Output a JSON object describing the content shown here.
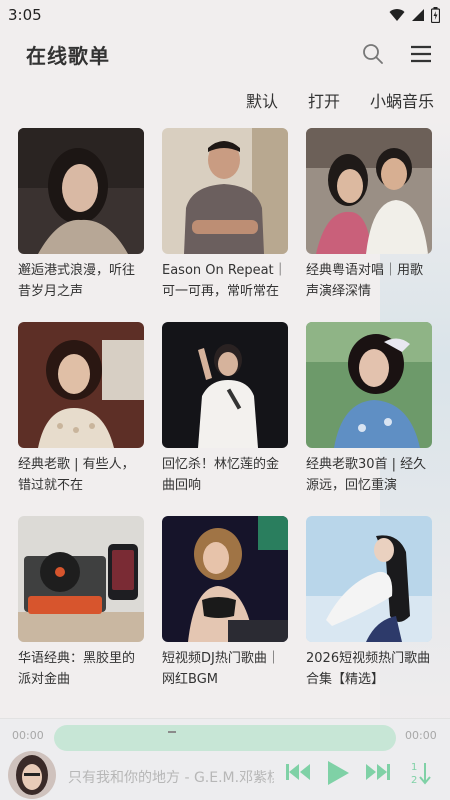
{
  "status_bar": {
    "time": "3:05"
  },
  "header": {
    "title": "在线歌单"
  },
  "filters": [
    "默认",
    "打开",
    "小蜗音乐"
  ],
  "playlists": [
    {
      "title": "邂逅港式浪漫，听往昔岁月之声"
    },
    {
      "title": "Eason On Repeat｜可一可再，常听常在"
    },
    {
      "title": "经典粤语对唱｜用歌声演绎深情"
    },
    {
      "title": "经典老歌 | 有些人，错过就不在"
    },
    {
      "title": "回忆杀！林忆莲的金曲回响"
    },
    {
      "title": "经典老歌30首 | 经久源远，回忆重演"
    },
    {
      "title": "华语经典：黑胶里的派对金曲"
    },
    {
      "title": "短视频DJ热门歌曲｜网红BGM"
    },
    {
      "title": "2026短视频热门歌曲合集【精选】"
    }
  ],
  "player": {
    "elapsed": "00:00",
    "duration": "00:00",
    "progress": 0,
    "now_playing": "只有我和你的地方 - G.E.M.邓紫棋",
    "colors": {
      "accent": "#7fd1a6",
      "track": "#c7e6d6"
    }
  }
}
